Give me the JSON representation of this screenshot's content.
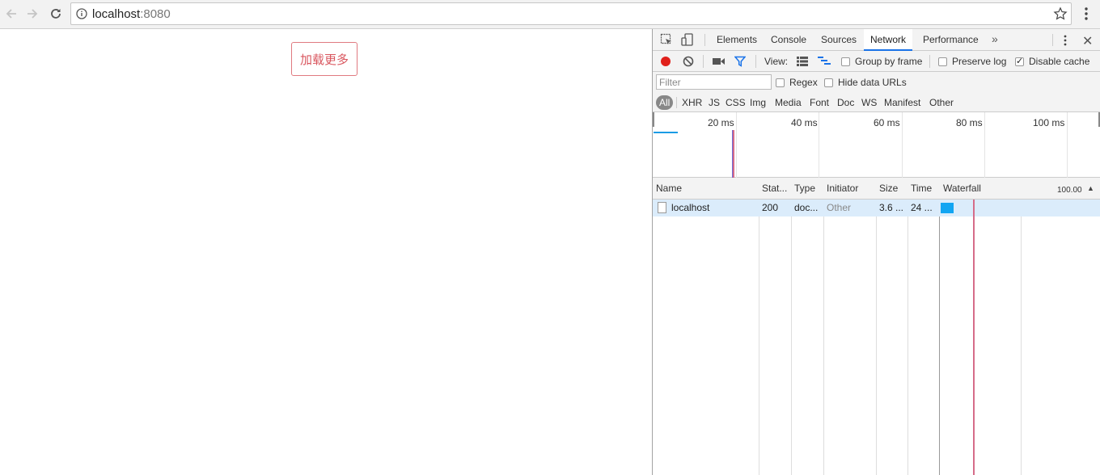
{
  "browser": {
    "url_host": "localhost",
    "url_port": ":8080",
    "icons": [
      "back-arrow-icon",
      "forward-arrow-icon",
      "reload-icon",
      "info-icon",
      "star-icon",
      "menu-dots-icon"
    ]
  },
  "page": {
    "load_more_label": "加载更多",
    "load_more_color": "#d9575f"
  },
  "devtools": {
    "tabs": [
      "Elements",
      "Console",
      "Sources",
      "Network",
      "Performance"
    ],
    "active_tab": "Network",
    "more_tabs": "»",
    "close": "✕",
    "toolbar": {
      "view_label": "View:",
      "group_by_frame": "Group by frame",
      "preserve_log": "Preserve log",
      "disable_cache": "Disable cache",
      "disable_cache_checked": true
    },
    "filter": {
      "placeholder": "Filter",
      "regex": "Regex",
      "hide_data_urls": "Hide data URLs"
    },
    "types": [
      "All",
      "XHR",
      "JS",
      "CSS",
      "Img",
      "Media",
      "Font",
      "Doc",
      "WS",
      "Manifest",
      "Other"
    ],
    "active_type": "All",
    "overview_ticks": [
      "20 ms",
      "40 ms",
      "60 ms",
      "80 ms",
      "100 ms"
    ],
    "columns": {
      "name": "Name",
      "status": "Stat...",
      "type": "Type",
      "initiator": "Initiator",
      "size": "Size",
      "time": "Time",
      "waterfall": "Waterfall",
      "waterfall_scale": "100.00"
    },
    "requests": [
      {
        "name": "localhost",
        "status": "200",
        "type": "doc...",
        "initiator": "Other",
        "size": "3.6 ...",
        "time": "24 ..."
      }
    ],
    "colors": {
      "record": "#e0201b",
      "waterfall_bar": "#11a5f2",
      "load_line": "#d56c89",
      "selected_row": "#dbecfb",
      "active_tab_underline": "#1a73e8"
    }
  }
}
